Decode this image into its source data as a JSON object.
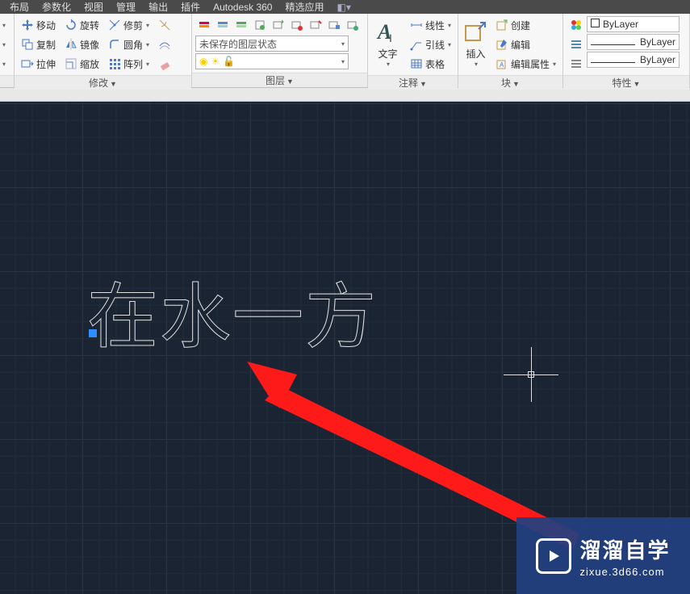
{
  "menubar": {
    "items": [
      "布局",
      "参数化",
      "视图",
      "管理",
      "输出",
      "插件",
      "Autodesk 360",
      "精选应用"
    ]
  },
  "ribbon": {
    "modify": {
      "title": "修改",
      "move": "移动",
      "copy": "复制",
      "stretch": "拉伸",
      "rotate": "旋转",
      "mirror": "镜像",
      "scale": "缩放",
      "trim": "修剪",
      "fillet": "圆角",
      "array": "阵列"
    },
    "layer": {
      "title": "图层",
      "state": "未保存的图层状态"
    },
    "annotation": {
      "title": "注释",
      "text": "文字",
      "linear": "线性",
      "leader": "引线",
      "table": "表格"
    },
    "block": {
      "title": "块",
      "insert": "插入",
      "create": "创建",
      "edit": "编辑",
      "editattr": "编辑属性"
    },
    "properties": {
      "title": "特性",
      "bylayer": "ByLayer"
    }
  },
  "canvas": {
    "drawing_text": "在水一方"
  },
  "watermark": {
    "brand": "溜溜自学",
    "url": "zixue.3d66.com"
  }
}
